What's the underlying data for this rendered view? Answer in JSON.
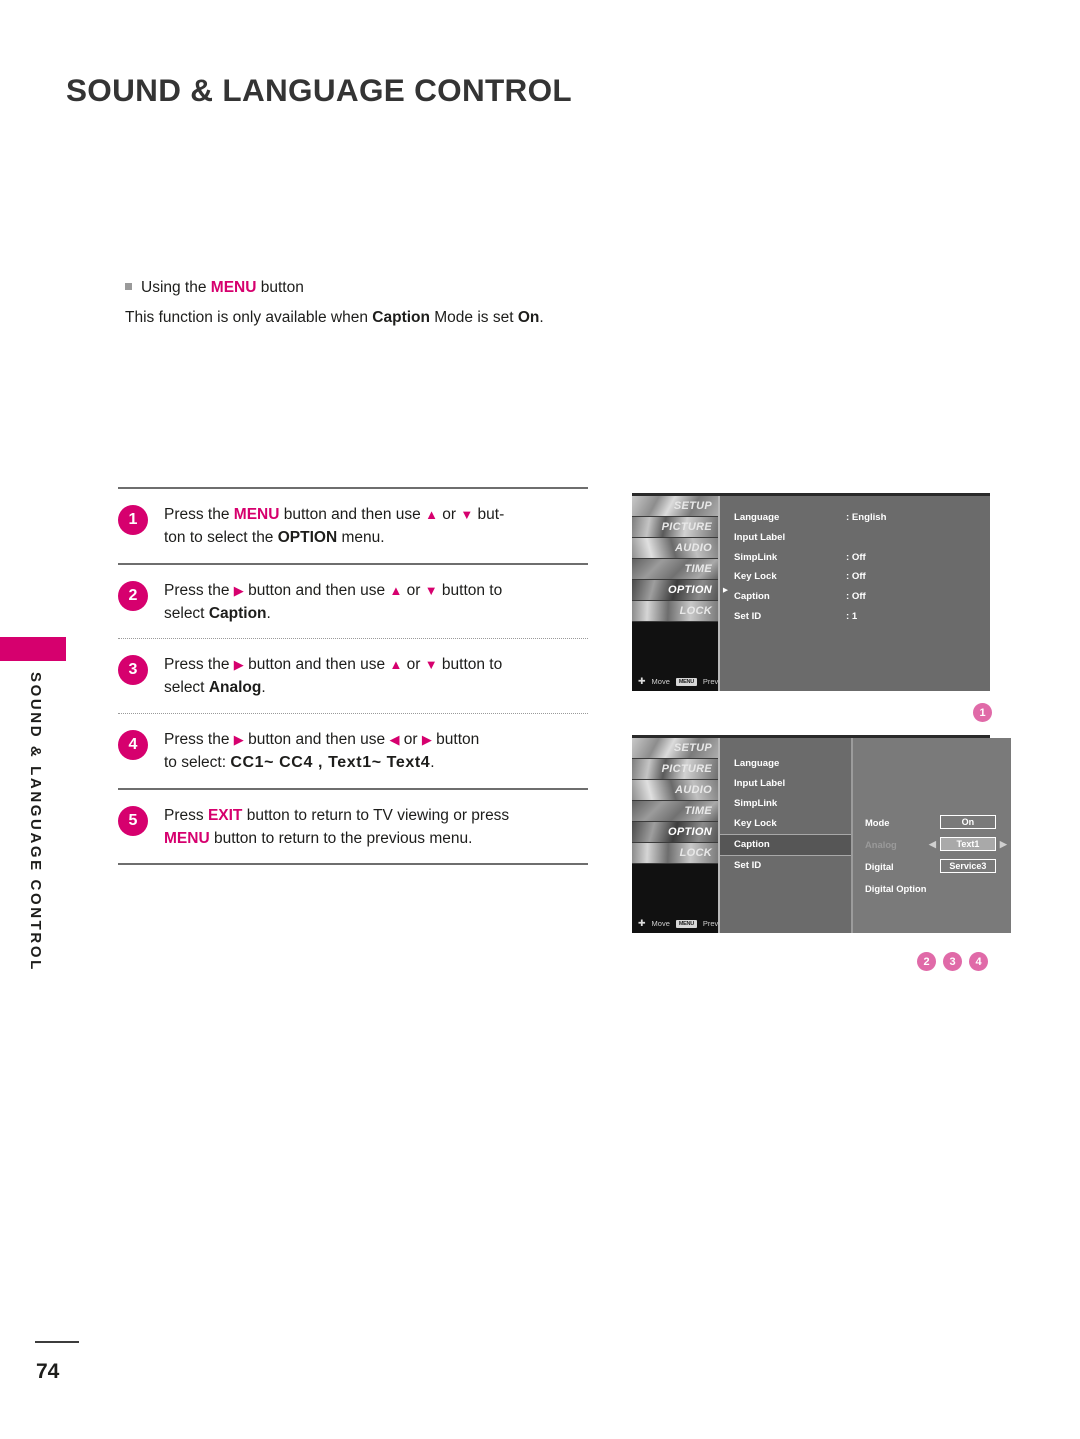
{
  "header": {
    "title": "SOUND & LANGUAGE CONTROL"
  },
  "side_tab": {
    "label": "SOUND & LANGUAGE CONTROL"
  },
  "intro": {
    "bullet_icon": "square-bullet-icon",
    "line1_pre": "Using the ",
    "line1_key": "MENU",
    "line1_post": " button",
    "line2_a": "This function is only available when ",
    "line2_b": "Caption",
    "line2_c": " Mode is set ",
    "line2_d": "On",
    "line2_e": "."
  },
  "steps": [
    {
      "number": "1",
      "parts": [
        {
          "t": "Press the ",
          "s": "n"
        },
        {
          "t": "MENU",
          "s": "m"
        },
        {
          "t": " button and then use ",
          "s": "n"
        },
        {
          "t": "▲",
          "s": "tri"
        },
        {
          "t": " or ",
          "s": "n"
        },
        {
          "t": "▼",
          "s": "tri"
        },
        {
          "t": " but-",
          "s": "n"
        },
        {
          "t": "\nton to select the ",
          "s": "n"
        },
        {
          "t": "OPTION",
          "s": "b"
        },
        {
          "t": " menu.",
          "s": "n"
        }
      ]
    },
    {
      "number": "2",
      "parts": [
        {
          "t": "Press the ",
          "s": "n"
        },
        {
          "t": "▶",
          "s": "tri"
        },
        {
          "t": " button and then use ",
          "s": "n"
        },
        {
          "t": "▲",
          "s": "tri"
        },
        {
          "t": " or ",
          "s": "n"
        },
        {
          "t": "▼",
          "s": "tri"
        },
        {
          "t": " button to",
          "s": "n"
        },
        {
          "t": "\nselect ",
          "s": "n"
        },
        {
          "t": "Caption",
          "s": "b"
        },
        {
          "t": ".",
          "s": "n"
        }
      ]
    },
    {
      "number": "3",
      "parts": [
        {
          "t": "Press the ",
          "s": "n"
        },
        {
          "t": "▶",
          "s": "tri"
        },
        {
          "t": " button and then use ",
          "s": "n"
        },
        {
          "t": "▲",
          "s": "tri"
        },
        {
          "t": " or ",
          "s": "n"
        },
        {
          "t": "▼",
          "s": "tri"
        },
        {
          "t": " button to",
          "s": "n"
        },
        {
          "t": "\nselect ",
          "s": "n"
        },
        {
          "t": "Analog",
          "s": "b"
        },
        {
          "t": ".",
          "s": "n"
        }
      ]
    },
    {
      "number": "4",
      "parts": [
        {
          "t": "Press the ",
          "s": "n"
        },
        {
          "t": "▶",
          "s": "tri"
        },
        {
          "t": " button and then use ",
          "s": "n"
        },
        {
          "t": "◀",
          "s": "tri"
        },
        {
          "t": " or ",
          "s": "n"
        },
        {
          "t": "▶",
          "s": "tri"
        },
        {
          "t": "  button",
          "s": "n"
        },
        {
          "t": "\nto select: ",
          "s": "n"
        },
        {
          "t": "CC1~ CC4 , Text1~ Text4",
          "s": "mono"
        },
        {
          "t": ".",
          "s": "n"
        }
      ]
    },
    {
      "number": "5",
      "parts": [
        {
          "t": "Press ",
          "s": "n"
        },
        {
          "t": "EXIT",
          "s": "m"
        },
        {
          "t": " button to return to TV viewing or press",
          "s": "n"
        },
        {
          "t": "\n",
          "s": "n"
        },
        {
          "t": "MENU",
          "s": "m"
        },
        {
          "t": " button to return to the previous menu.",
          "s": "n"
        }
      ]
    }
  ],
  "osd_common": {
    "tabs": [
      "SETUP",
      "PICTURE",
      "AUDIO",
      "TIME",
      "OPTION",
      "LOCK"
    ],
    "selected_tab": "OPTION",
    "status_move": "Move",
    "status_prev": "Prev",
    "status_menu_key": "MENU",
    "nav_icon": "dpad-icon",
    "menu_key_icon": "menu-key-icon"
  },
  "osd_1": {
    "items": [
      {
        "key": "Language",
        "value": ": English"
      },
      {
        "key": "Input Label",
        "value": ""
      },
      {
        "key": "SimpLink",
        "value": ": Off"
      },
      {
        "key": "Key Lock",
        "value": ": Off"
      },
      {
        "key": "Caption",
        "value": ": Off"
      },
      {
        "key": "Set ID",
        "value": ": 1"
      }
    ],
    "callout": "1"
  },
  "osd_2": {
    "list": [
      "Language",
      "Input Label",
      "SimpLink",
      "Key Lock",
      "Caption",
      "Set ID"
    ],
    "selected": "Caption",
    "detail": {
      "mode_label": "Mode",
      "mode_value": "On",
      "analog_label": "Analog",
      "analog_value": "Text1",
      "analog_left_arrow": "◀",
      "analog_right_arrow": "▶",
      "digital_label": "Digital",
      "digital_value": "Service3",
      "digital_option_label": "Digital Option"
    },
    "callouts": [
      "2",
      "3",
      "4"
    ]
  },
  "footer": {
    "page_number": "74"
  },
  "colors": {
    "accent_magenta": "#d6006e",
    "callout_pink": "#e06aa8",
    "text": "#1d1d1b",
    "rule": "#6e6e6e"
  }
}
